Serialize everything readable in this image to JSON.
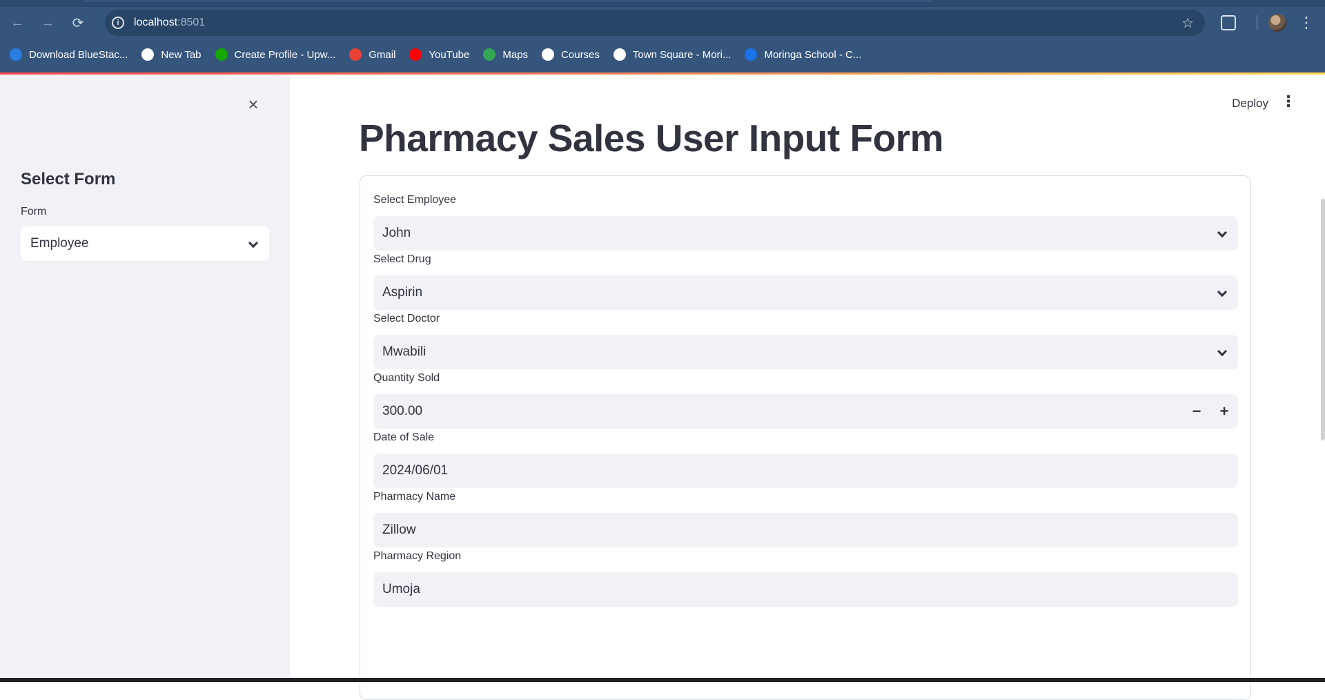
{
  "browser": {
    "url_host": "localhost",
    "url_port": ":8501",
    "bookmarks": [
      {
        "label": "Download BlueStac...",
        "icon": "bluestacks-icon",
        "color": "#2a7de1"
      },
      {
        "label": "New Tab",
        "icon": "globe-icon",
        "color": "#ffffff"
      },
      {
        "label": "Create Profile - Upw...",
        "icon": "upwork-icon",
        "color": "#14a800"
      },
      {
        "label": "Gmail",
        "icon": "gmail-icon",
        "color": "#ea4335"
      },
      {
        "label": "YouTube",
        "icon": "youtube-icon",
        "color": "#ff0000"
      },
      {
        "label": "Maps",
        "icon": "maps-icon",
        "color": "#34a853"
      },
      {
        "label": "Courses",
        "icon": "google-icon",
        "color": "#ffffff"
      },
      {
        "label": "Town Square - Mori...",
        "icon": "town-square-icon",
        "color": "#ffffff"
      },
      {
        "label": "Moringa School - C...",
        "icon": "calendar-icon",
        "color": "#1a73e8"
      }
    ]
  },
  "sidebar": {
    "heading": "Select Form",
    "form_label": "Form",
    "form_value": "Employee"
  },
  "header": {
    "deploy_label": "Deploy"
  },
  "main": {
    "title": "Pharmacy Sales User Input Form",
    "fields": [
      {
        "label": "Select Employee",
        "value": "John",
        "kind": "select"
      },
      {
        "label": "Select Drug",
        "value": "Aspirin",
        "kind": "select"
      },
      {
        "label": "Select Doctor",
        "value": "Mwabili",
        "kind": "select"
      },
      {
        "label": "Quantity Sold",
        "value": "300.00",
        "kind": "number"
      },
      {
        "label": "Date of Sale",
        "value": "2024/06/01",
        "kind": "date"
      },
      {
        "label": "Pharmacy Name",
        "value": "Zillow",
        "kind": "text"
      },
      {
        "label": "Pharmacy Region",
        "value": "Umoja",
        "kind": "text"
      }
    ],
    "stepper": {
      "minus": "−",
      "plus": "+"
    }
  }
}
